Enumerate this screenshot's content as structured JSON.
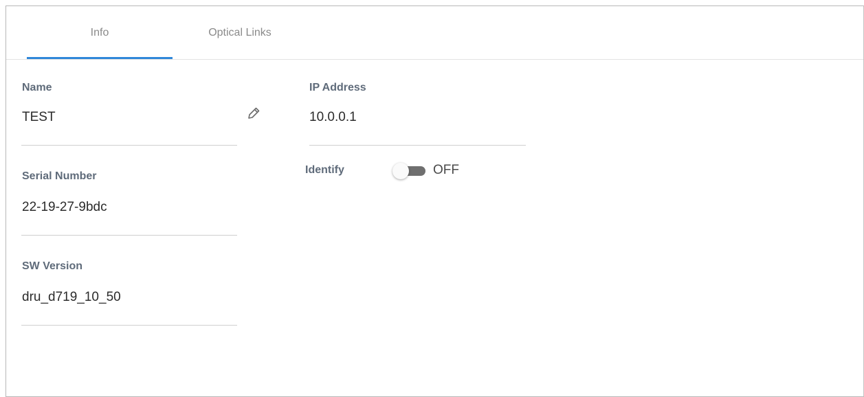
{
  "tabs": [
    {
      "label": "Info",
      "active": true
    },
    {
      "label": "Optical Links",
      "active": false
    }
  ],
  "fields": {
    "name": {
      "label": "Name",
      "value": "TEST"
    },
    "serial_number": {
      "label": "Serial Number",
      "value": "22-19-27-9bdc"
    },
    "sw_version": {
      "label": "SW Version",
      "value": "dru_d719_10_50"
    },
    "ip_address": {
      "label": "IP Address",
      "value": "10.0.0.1"
    }
  },
  "identify": {
    "label": "Identify",
    "state": "OFF",
    "on": false
  },
  "icons": {
    "edit": "pencil-icon"
  },
  "colors": {
    "accent": "#2f87d9",
    "label": "#5f6b7a",
    "toggle_track": "#6f6f6f"
  }
}
